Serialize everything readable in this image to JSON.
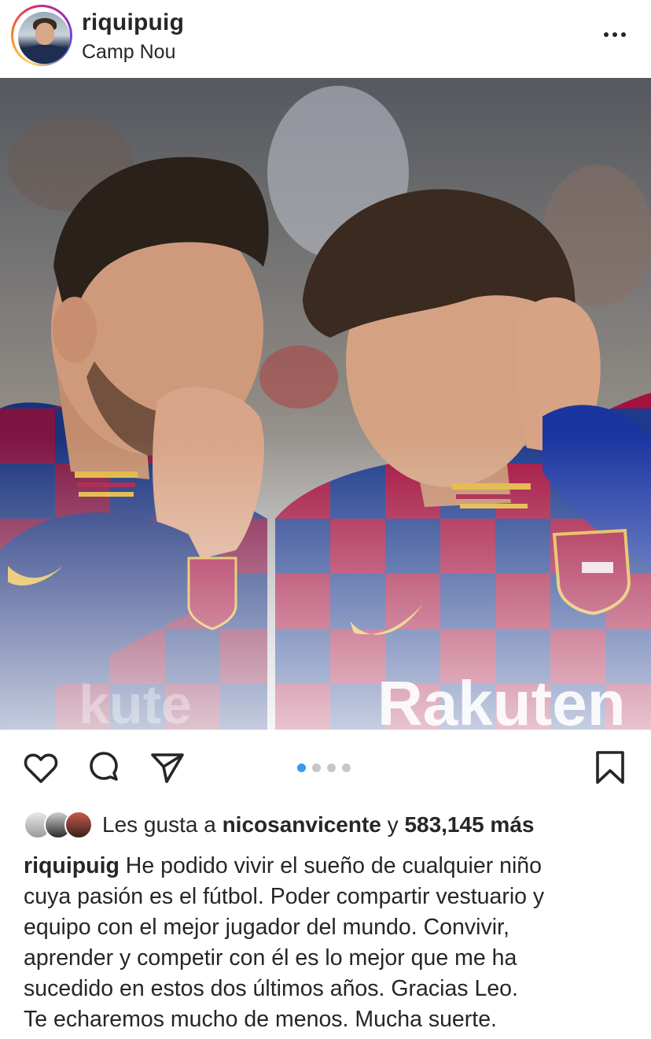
{
  "header": {
    "username": "riquipuig",
    "location": "Camp Nou"
  },
  "photo": {
    "description_icon": "post-photo"
  },
  "actions": {
    "carousel_total": 4,
    "carousel_active": 1
  },
  "likes": {
    "prefix": "Les gusta a ",
    "user": "nicosanvicente",
    "middle": " y ",
    "count": "583,145 más"
  },
  "caption": {
    "username": "riquipuig",
    "lines": [
      " He podido vivir el sueño de cualquier niño",
      "cuya pasión es el fútbol. Poder compartir vestuario y",
      "equipo con el mejor jugador del mundo. Convivir,",
      "aprender y competir con él es lo mejor  que me ha",
      "sucedido en estos dos últimos años. Gracias Leo.",
      "Te echaremos mucho de menos. Mucha suerte."
    ]
  },
  "colors": {
    "accent": "#3897f0",
    "text": "#262626",
    "jersey_blue": "#1d3a8c",
    "jersey_red": "#a3123f"
  }
}
